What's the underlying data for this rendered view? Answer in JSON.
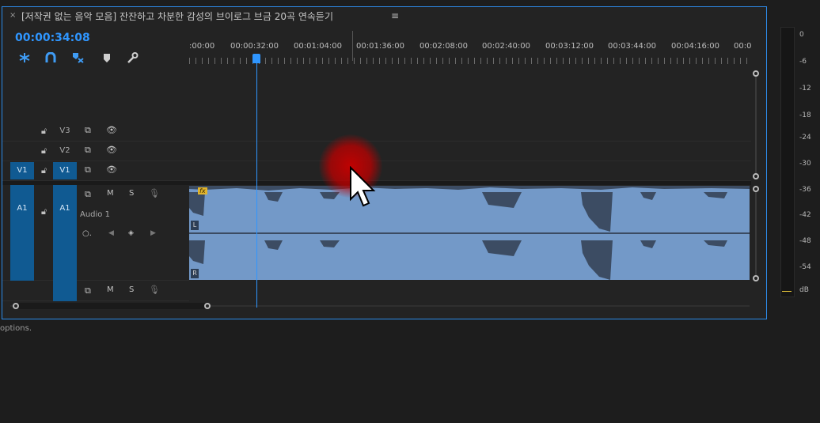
{
  "panel": {
    "close_glyph": "×",
    "sequence_title": "[저작권 없는 음악 모음] 잔잔하고 차분한 감성의 브이로그 브금 20곡 연속듣기",
    "menu_glyph": "≡",
    "timecode": "00:00:34:08"
  },
  "toolbar": {
    "icons": [
      "snap-icon",
      "linked-selection-icon",
      "add-marker-icon",
      "marker-icon",
      "wrench-icon"
    ]
  },
  "ruler": {
    "labels": [
      ":00:00",
      "00:00:32:00",
      "00:01:04:00",
      "00:01:36:00",
      "00:02:08:00",
      "00:02:40:00",
      "00:03:12:00",
      "00:03:44:00",
      "00:04:16:00",
      "00:0"
    ]
  },
  "tracks": {
    "v3": {
      "target": "V3"
    },
    "v2": {
      "target": "V2"
    },
    "v1": {
      "source": "V1",
      "target": "V1"
    },
    "a1": {
      "source": "A1",
      "target": "A1",
      "name": "Audio 1",
      "mute": "M",
      "solo": "S"
    },
    "a2": {
      "mute": "M",
      "solo": "S"
    }
  },
  "clip": {
    "fx_badge": "fx",
    "left_channel": "L",
    "right_channel": "R"
  },
  "status": {
    "text": "options."
  },
  "meter": {
    "labels": [
      "0",
      "-6",
      "-12",
      "-18",
      "-24",
      "-30",
      "-36",
      "-42",
      "-48",
      "-54",
      "dB"
    ]
  },
  "colors": {
    "accent": "#2f96ff",
    "clip_audio": "#7399c8",
    "track_target": "#105a92",
    "meter_clip": "#e02b2b"
  }
}
